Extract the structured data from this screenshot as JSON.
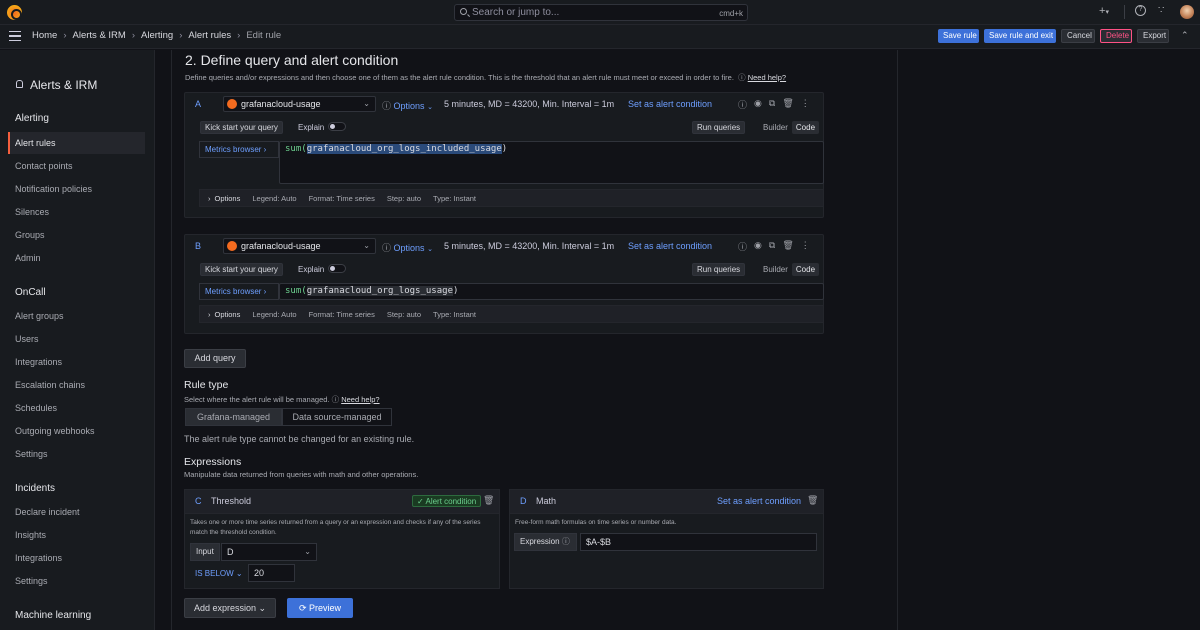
{
  "topbar": {
    "search_placeholder": "Search or jump to...",
    "search_shortcut": "cmd+k",
    "plus_label": "+",
    "help_icon": "help-icon",
    "news_icon": "rss-icon"
  },
  "breadcrumbs": [
    "Home",
    "Alerts & IRM",
    "Alerting",
    "Alert rules",
    "Edit rule"
  ],
  "actions": {
    "save_rule": "Save rule",
    "save_exit": "Save rule and exit",
    "cancel": "Cancel",
    "delete": "Delete",
    "export": "Export"
  },
  "sidebar": {
    "title": "Alerts & IRM",
    "sections": [
      {
        "title": "Alerting",
        "items": [
          "Alert rules",
          "Contact points",
          "Notification policies",
          "Silences",
          "Groups",
          "Admin"
        ]
      },
      {
        "title": "OnCall",
        "items": [
          "Alert groups",
          "Users",
          "Integrations",
          "Escalation chains",
          "Schedules",
          "Outgoing webhooks",
          "Settings"
        ]
      },
      {
        "title": "Incidents",
        "items": [
          "Declare incident",
          "Insights",
          "Integrations",
          "Settings"
        ]
      },
      {
        "title": "Machine learning",
        "items": []
      }
    ]
  },
  "section": {
    "title": "2. Define query and alert condition",
    "desc": "Define queries and/or expressions and then choose one of them as the alert rule condition. This is the threshold that an alert rule must meet or exceed in order to fire.",
    "help": "Need help?"
  },
  "queries": [
    {
      "letter": "A",
      "datasource": "grafanacloud-usage",
      "options_label": "Options",
      "options_summary": "5 minutes, MD = 43200, Min. Interval = 1m",
      "set_condition": "Set as alert condition",
      "kick_start": "Kick start your query",
      "explain": "Explain",
      "run": "Run queries",
      "builder": "Builder",
      "code": "Code",
      "metrics_browser": "Metrics browser",
      "expr_fn": "sum(",
      "expr_metric": "grafanacloud_org_logs_included_usage",
      "expr_end": ")",
      "opt_title": "Options",
      "legend": "Legend: Auto",
      "format": "Format: Time series",
      "step": "Step: auto",
      "type": "Type: Instant"
    },
    {
      "letter": "B",
      "datasource": "grafanacloud-usage",
      "options_label": "Options",
      "options_summary": "5 minutes, MD = 43200, Min. Interval = 1m",
      "set_condition": "Set as alert condition",
      "kick_start": "Kick start your query",
      "explain": "Explain",
      "run": "Run queries",
      "builder": "Builder",
      "code": "Code",
      "metrics_browser": "Metrics browser",
      "expr_fn": "sum(",
      "expr_metric": "grafanacloud_org_logs_usage",
      "expr_end": ")",
      "opt_title": "Options",
      "legend": "Legend: Auto",
      "format": "Format: Time series",
      "step": "Step: auto",
      "type": "Type: Instant"
    }
  ],
  "add_query": "Add query",
  "rule_type": {
    "title": "Rule type",
    "desc": "Select where the alert rule will be managed.",
    "help": "Need help?",
    "tabs": [
      "Grafana-managed",
      "Data source-managed"
    ],
    "note": "The alert rule type cannot be changed for an existing rule."
  },
  "expressions": {
    "title": "Expressions",
    "desc": "Manipulate data returned from queries with math and other operations.",
    "threshold": {
      "letter": "C",
      "name": "Threshold",
      "badge": "Alert condition",
      "desc1": "Takes one or more time series returned from a query or an expression and checks if any of the series",
      "desc2": "match the threshold condition.",
      "input_label": "Input",
      "input_value": "D",
      "op": "IS BELOW",
      "value": "20"
    },
    "math": {
      "letter": "D",
      "name": "Math",
      "set_condition": "Set as alert condition",
      "desc": "Free-form math formulas on time series or number data.",
      "expr_label": "Expression",
      "expr_value": "$A-$B"
    }
  },
  "add_expression": "Add expression",
  "preview": "Preview"
}
